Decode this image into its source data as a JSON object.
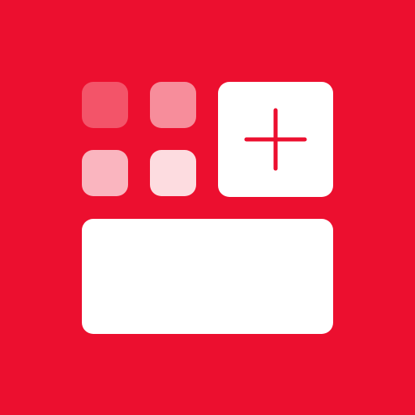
{
  "app_icon": {
    "background_color": "#EC0F2F",
    "tiles": [
      {
        "name": "tile-1",
        "color": "#F35469"
      },
      {
        "name": "tile-2",
        "color": "#F78D9B"
      },
      {
        "name": "tile-3",
        "color": "#FAB5BF"
      },
      {
        "name": "tile-4",
        "color": "#FDDCE0"
      }
    ],
    "add_tile": {
      "color": "#FFFFFF",
      "icon": "plus-icon",
      "icon_color": "#EC0F2F"
    },
    "wide_widget": {
      "color": "#FFFFFF"
    }
  }
}
